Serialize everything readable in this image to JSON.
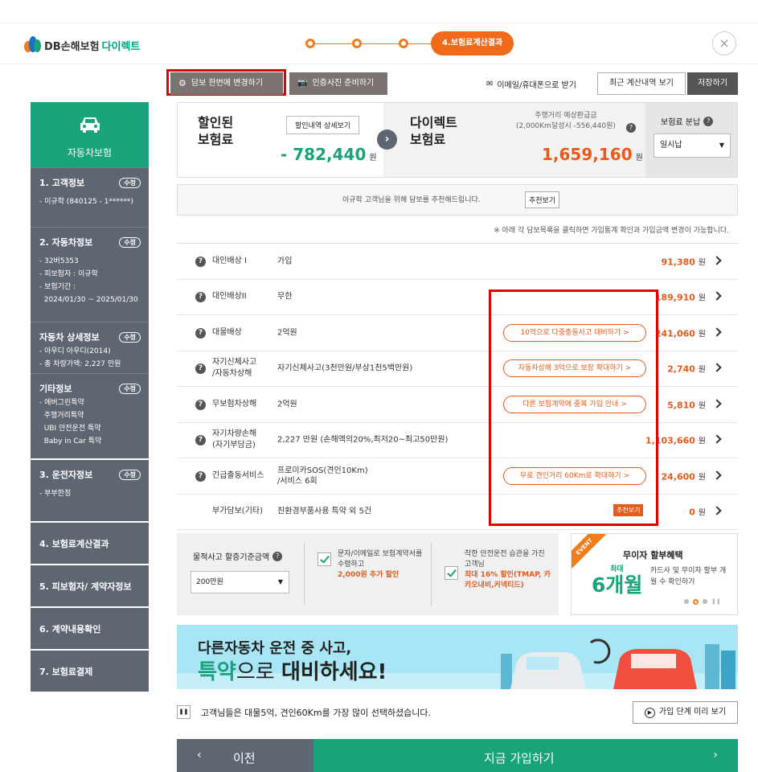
{
  "header": {
    "logo_text": "DB손해보험",
    "logo_direct": "다이렉트",
    "step_current": "4.보험료계산결과",
    "close_icon": "×"
  },
  "toolbar": {
    "change_coverage": "담보 한번에 변경하기",
    "photo_ready": "인증사진 준비하기",
    "email_label": "이메일/휴대폰으로 받기",
    "recent_calc": "최근 계산내역 보기",
    "save": "저장하기"
  },
  "sidebar": {
    "car_title": "자동차보험",
    "edit_label": "수정",
    "sections": [
      {
        "title": "1. 고객정보",
        "lines": [
          "- 이규학 (840125 - 1******)"
        ]
      },
      {
        "title": "2. 자동차정보",
        "lines": [
          "- 32버5353",
          "- 피보험자 : 이규학",
          "- 보험기간 :",
          "  2024/01/30 ~ 2025/01/30"
        ]
      },
      {
        "title": "자동차 상세정보",
        "lines": [
          "- 아우디 아우디(2014)",
          "- 총 차량가액: 2,227 만원"
        ]
      },
      {
        "title": "기타정보",
        "lines": [
          "- 에버그린특약",
          "  주행거리특약",
          "  UBI 안전운전 특약",
          "  Baby in Car 특약"
        ]
      },
      {
        "title": "3. 운전자정보",
        "lines": [
          "- 부부한정"
        ]
      },
      {
        "title": "4. 보험료계산결과",
        "lines": []
      },
      {
        "title": "5. 피보험자/ 계약자정보",
        "lines": []
      },
      {
        "title": "6. 계약내용확인",
        "lines": []
      },
      {
        "title": "7. 보험료결제",
        "lines": []
      }
    ]
  },
  "summary": {
    "discount_label_1": "할인된",
    "discount_label_2": "보험료",
    "detail_btn": "할인내역 상세보기",
    "discount_amount": "- 782,440",
    "won": "원",
    "direct_label_1": "다이렉트",
    "direct_label_2": "보험료",
    "refund_label": "주행거리 예상환급금",
    "refund_sub": "(2,000Km달성시 -556,440원)",
    "direct_amount": "1,659,160",
    "installment_label": "보험료 분납",
    "installment_value": "일시납"
  },
  "recommend": {
    "text": "이규학 고객님을 위해 담보를 추천해드립니다.",
    "btn": "추천보기"
  },
  "notice": "※ 아래 각 담보목록을 클릭하면 가입통계 확인과 가입금액 변경이 가능합니다.",
  "coverages": [
    {
      "name": "대인배상 I",
      "value": "가입",
      "pill": "",
      "amount": "91,380"
    },
    {
      "name": "대인배상II",
      "value": "무한",
      "pill": "",
      "amount": "189,910"
    },
    {
      "name": "대물배상",
      "value": "2억원",
      "pill": "10억으로 다중충돌사고 대비하기 >",
      "amount": "241,060"
    },
    {
      "name": "자기신체사고\n/자동차상해",
      "value": "자기신체사고(3천만원/부상1천5백만원)",
      "pill": "자동차상해 3억으로 보장 확대하기 >",
      "amount": "2,740"
    },
    {
      "name": "무보험차상해",
      "value": "2억원",
      "pill": "다른 보험계약에 중복 가입 안내 >",
      "amount": "5,810"
    },
    {
      "name": "자기차량손해\n(자기부담금)",
      "value": "2,227 만원 (손해액의20%,최저20~최고50만원)",
      "pill": "",
      "amount": "1,103,660"
    },
    {
      "name": "긴급출동서비스",
      "value": "프로미카SOS(견인10Km)\n/서비스 6회",
      "pill": "무료 견인거리 60Km로 확대하기 >",
      "amount": "24,600"
    },
    {
      "name": "부가담보(기타)",
      "value": "친환경부품사용 특약 외 5건",
      "pill": "",
      "amount": "0",
      "badge": "추천보기"
    }
  ],
  "options": {
    "accident_label": "물적사고 할증기준금액",
    "accident_value": "200만원",
    "sms_text": "문자/이메일로 보험계약서를 수령하고",
    "sms_discount": "2,000원 추가 할인",
    "safe_text": "착한 안전운전 습관을 가진 고객님",
    "safe_discount": "최대 16% 할인(TMAP, 카카오내비,커넥티드)"
  },
  "event": {
    "tag": "EVENT",
    "title": "무이자 할부혜택",
    "big_small": "최대",
    "big": "6개월",
    "desc": "카드사 및 무이자 할부 개월 수 확인하기"
  },
  "banner": {
    "line1": "다른자동차 운전 중 사고,",
    "line2a": "특약",
    "line2b": "으로 ",
    "line2c": "대비하세요!"
  },
  "bottom": {
    "note": "고객님들은 대물5억, 견인60Km를 가장 많이 선택하셨습니다.",
    "preview_btn": "가입 단계 미리 보기",
    "prev": "이전",
    "next": "지금 가입하기"
  },
  "colors": {
    "green": "#19a37b",
    "orange": "#e85a1a",
    "slate": "#5e6672",
    "red_highlight": "#e30000"
  }
}
